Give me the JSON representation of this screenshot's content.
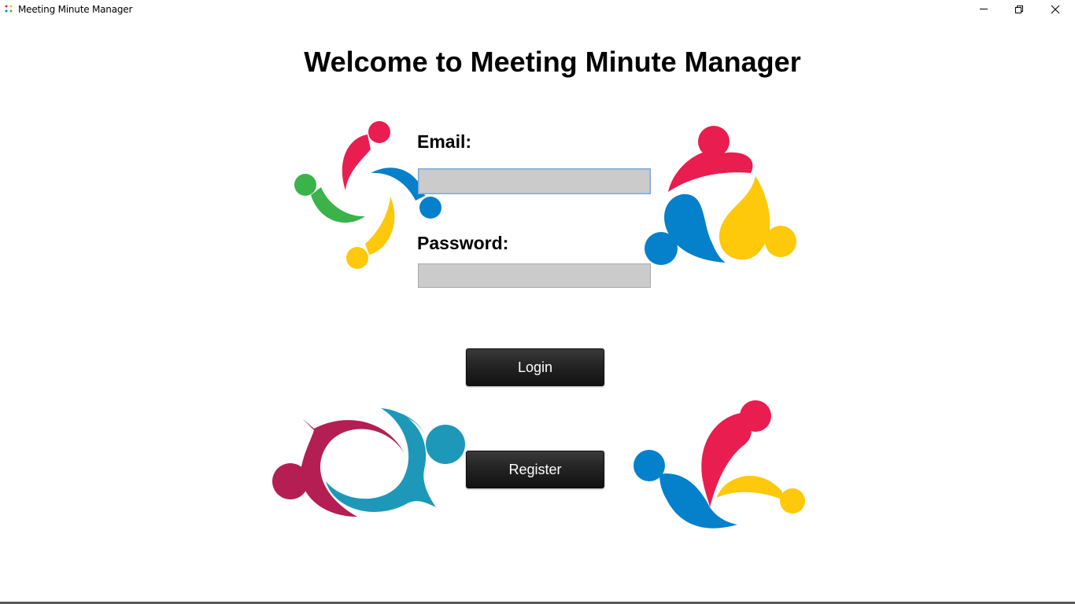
{
  "window": {
    "title": "Meeting Minute Manager",
    "icons": [
      "app-icon",
      "minimize-icon",
      "restore-icon",
      "close-icon"
    ]
  },
  "main": {
    "heading": "Welcome to Meeting Minute Manager",
    "email_label": "Email:",
    "email_value": "",
    "password_label": "Password:",
    "password_value": "",
    "login_label": "Login",
    "register_label": "Register"
  },
  "colors": {
    "red": "#e91d4f",
    "blue": "#0580cb",
    "green": "#3bb34a",
    "yellow": "#fec80b",
    "maroon": "#b41e52",
    "teal": "#1e98b8",
    "field_bg": "#cbcbcb",
    "button_bg": "#1e1e1e"
  },
  "decorations": [
    "people-circle-logo",
    "people-trio-logo",
    "speech-ring-logo",
    "people-trio-logo"
  ]
}
